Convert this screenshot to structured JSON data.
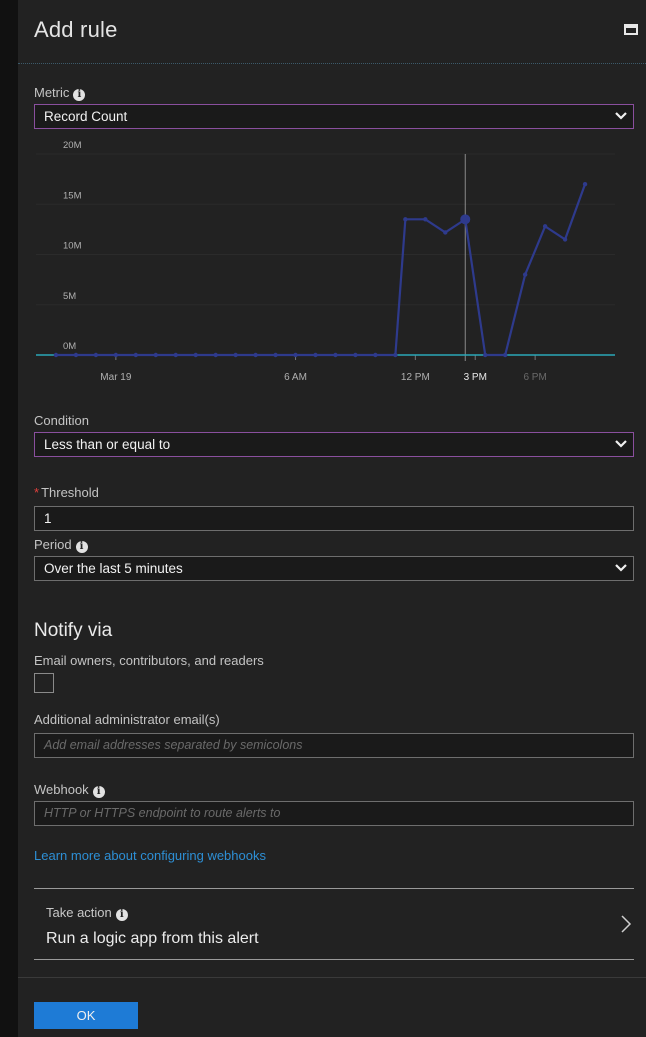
{
  "header": {
    "title": "Add rule"
  },
  "metric": {
    "label": "Metric",
    "value": "Record Count"
  },
  "chart_data": {
    "type": "line",
    "x_tick_labels": [
      "Mar 19",
      "6 AM",
      "12 PM",
      "3 PM",
      "6 PM"
    ],
    "y_tick_labels": [
      "20M",
      "15M",
      "10M",
      "5M",
      "0M"
    ],
    "ylim": [
      0,
      20
    ],
    "x_range_hours": [
      -1,
      28
    ],
    "series": [
      {
        "color": "#2e3a8c",
        "points": [
          [
            0,
            0
          ],
          [
            1,
            0
          ],
          [
            2,
            0
          ],
          [
            3,
            0
          ],
          [
            4,
            0
          ],
          [
            5,
            0
          ],
          [
            6,
            0
          ],
          [
            7,
            0
          ],
          [
            8,
            0
          ],
          [
            9,
            0
          ],
          [
            10,
            0
          ],
          [
            11,
            0
          ],
          [
            12,
            0
          ],
          [
            13,
            0
          ],
          [
            14,
            0
          ],
          [
            15,
            0
          ],
          [
            16,
            0
          ],
          [
            17,
            0
          ],
          [
            17.5,
            13.5
          ],
          [
            18.5,
            13.5
          ],
          [
            19.5,
            12.2
          ],
          [
            20.5,
            13.5
          ],
          [
            21.5,
            0
          ],
          [
            22.5,
            0
          ],
          [
            23.5,
            8
          ],
          [
            24.5,
            12.8
          ],
          [
            25.5,
            11.5
          ],
          [
            26.5,
            17
          ]
        ]
      }
    ],
    "threshold_line_value": 0,
    "threshold_color": "#2aa7b8",
    "cursor_x": 20.5,
    "highlight_point": [
      20.5,
      13.5
    ]
  },
  "condition": {
    "label": "Condition",
    "value": "Less than or equal to"
  },
  "threshold": {
    "label": "Threshold",
    "required_mark": "*",
    "value": "1"
  },
  "period": {
    "label": "Period",
    "value": "Over the last 5 minutes"
  },
  "notify": {
    "title": "Notify via",
    "email_owners_label": "Email owners, contributors, and readers",
    "admin_email_label": "Additional administrator email(s)",
    "admin_email_placeholder": "Add email addresses separated by semicolons",
    "webhook_label": "Webhook",
    "webhook_placeholder": "HTTP or HTTPS endpoint to route alerts to",
    "learn_more": "Learn more about configuring webhooks"
  },
  "action": {
    "subtitle": "Take action",
    "title": "Run a logic app from this alert"
  },
  "footer": {
    "ok_label": "OK"
  }
}
